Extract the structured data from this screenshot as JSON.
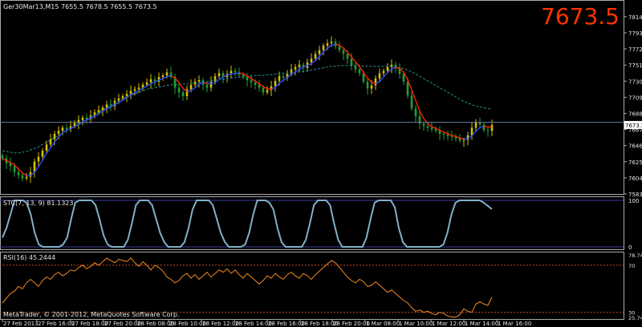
{
  "header": {
    "symbol_info": "Ger30Mar13,M15  7655.5 7678.5 7655.5 7673.5",
    "big_price": "7673.5"
  },
  "colors": {
    "up": "#d4c100",
    "down": "#1ea233",
    "fast_ma": "#ff2200",
    "slow_ma": "#2a8f8f",
    "blue_ma": "#2d49ff",
    "stc": "#7fb0c8",
    "rsi": "#f08a1e",
    "level": "#c84a1e",
    "price_line": "#6a7fa0"
  },
  "copyright": "MetaTrader, © 2001-2012, MetaQuotes Software Corp.",
  "chart_data": [
    {
      "type": "candlestick",
      "name": "main",
      "y_ticks": [
        "7814.6",
        "7793.6",
        "7772.6",
        "7751.6",
        "7730.6",
        "7709.6",
        "7688.6",
        "7667.6",
        "7646.6",
        "7625.6",
        "7604.6",
        "7583.6"
      ],
      "ylim": [
        7583.6,
        7828
      ],
      "current_price_label": "7673.5",
      "current_price": 7673.5,
      "bid_level": 7677,
      "x_labels": [
        "27 Feb 2013",
        "27 Feb 16:00",
        "27 Feb 18:00",
        "27 Feb 20:00",
        "28 Feb 08:00",
        "28 Feb 10:00",
        "28 Feb 12:00",
        "28 Feb 14:00",
        "28 Feb 16:00",
        "28 Feb 18:00",
        "28 Feb 20:00",
        "1 Mar 08:00",
        "1 Mar 10:00",
        "1 Mar 12:00",
        "1 Mar 14:00",
        "1 Mar 16:00"
      ],
      "close": [
        7630,
        7624,
        7620,
        7612,
        7608,
        7604,
        7606,
        7612,
        7626,
        7632,
        7640,
        7648,
        7655,
        7662,
        7666,
        7670,
        7668,
        7672,
        7676,
        7680,
        7683,
        7681,
        7686,
        7690,
        7693,
        7696,
        7700,
        7698,
        7705,
        7708,
        7711,
        7714,
        7718,
        7720,
        7722,
        7726,
        7729,
        7733,
        7730,
        7736,
        7738,
        7742,
        7736,
        7722,
        7716,
        7711,
        7720,
        7726,
        7730,
        7732,
        7726,
        7722,
        7730,
        7737,
        7741,
        7736,
        7740,
        7744,
        7742,
        7739,
        7736,
        7732,
        7729,
        7726,
        7722,
        7716,
        7719,
        7724,
        7731,
        7737,
        7735,
        7740,
        7746,
        7749,
        7752,
        7748,
        7755,
        7760,
        7766,
        7771,
        7777,
        7780,
        7782,
        7776,
        7771,
        7766,
        7760,
        7751,
        7746,
        7741,
        7730,
        7721,
        7725,
        7734,
        7741,
        7744,
        7749,
        7752,
        7748,
        7740,
        7730,
        7712,
        7695,
        7685,
        7675,
        7672,
        7670,
        7668,
        7666,
        7662,
        7661,
        7659,
        7658,
        7656,
        7653,
        7654,
        7660,
        7670,
        7677,
        7674,
        7667,
        7666,
        7673.5
      ],
      "sma_slow": [
        7640,
        7639,
        7638,
        7637,
        7637,
        7638,
        7639,
        7641,
        7643,
        7645,
        7648,
        7651,
        7654,
        7657,
        7660,
        7663,
        7666,
        7669,
        7672,
        7675,
        7678,
        7681,
        7684,
        7687,
        7690,
        7693,
        7696,
        7699,
        7702,
        7705,
        7708,
        7710,
        7712,
        7714,
        7716,
        7718,
        7720,
        7721,
        7722,
        7723,
        7724,
        7725,
        7726,
        7726,
        7726,
        7727,
        7727,
        7728,
        7728,
        7729,
        7729,
        7730,
        7731,
        7732,
        7733,
        7733,
        7734,
        7735,
        7735,
        7736,
        7736,
        7737,
        7737,
        7738,
        7738,
        7738,
        7739,
        7739,
        7740,
        7740,
        7741,
        7741,
        7742,
        7742,
        7743,
        7743,
        7744,
        7745,
        7746,
        7747,
        7748,
        7749,
        7750,
        7750,
        7751,
        7751,
        7751,
        7751,
        7751,
        7751,
        7750,
        7750,
        7750,
        7750,
        7750,
        7750,
        7750,
        7750,
        7749,
        7748,
        7747,
        7745,
        7743,
        7740,
        7737,
        7734,
        7731,
        7728,
        7725,
        7722,
        7719,
        7716,
        7713,
        7710,
        7707,
        7704,
        7702,
        7700,
        7698,
        7697,
        7696,
        7695,
        7694
      ]
    },
    {
      "type": "line",
      "name": "STC",
      "label": "STC(7, 13, 9) 81.1323",
      "y_ticks": [
        "100",
        "0"
      ],
      "ylim": [
        0,
        100
      ],
      "values": [
        20,
        40,
        70,
        100,
        100,
        100,
        95,
        70,
        30,
        5,
        0,
        0,
        0,
        0,
        0,
        5,
        20,
        60,
        95,
        100,
        100,
        100,
        100,
        90,
        60,
        25,
        5,
        0,
        0,
        0,
        0,
        15,
        50,
        90,
        100,
        100,
        100,
        90,
        60,
        30,
        10,
        0,
        0,
        0,
        0,
        10,
        40,
        80,
        100,
        100,
        100,
        100,
        90,
        60,
        30,
        10,
        0,
        0,
        0,
        0,
        5,
        30,
        70,
        100,
        100,
        100,
        95,
        80,
        40,
        10,
        0,
        0,
        0,
        0,
        0,
        15,
        50,
        90,
        100,
        100,
        100,
        90,
        50,
        15,
        0,
        0,
        0,
        0,
        0,
        0,
        20,
        60,
        95,
        100,
        100,
        100,
        100,
        85,
        40,
        10,
        0,
        0,
        0,
        0,
        0,
        0,
        0,
        0,
        0,
        5,
        30,
        70,
        95,
        100,
        100,
        100,
        100,
        100,
        100,
        95,
        88,
        81
      ]
    },
    {
      "type": "line",
      "name": "RSI",
      "label": "RSI(16) 45.2444",
      "y_ticks": [
        "70",
        "78.7437",
        "30",
        "25.7491"
      ],
      "ylim": [
        25.7491,
        78.7437
      ],
      "levels": [
        70,
        30
      ],
      "values": [
        38,
        42,
        46,
        48,
        52,
        50,
        55,
        58,
        55,
        52,
        57,
        60,
        58,
        62,
        64,
        61,
        63,
        66,
        65,
        68,
        70,
        67,
        69,
        72,
        70,
        73,
        76,
        74,
        72,
        75,
        74,
        73,
        76,
        72,
        69,
        73,
        70,
        66,
        70,
        68,
        65,
        60,
        58,
        55,
        57,
        61,
        63,
        59,
        62,
        58,
        61,
        64,
        60,
        63,
        66,
        64,
        67,
        63,
        66,
        62,
        59,
        63,
        60,
        57,
        54,
        57,
        61,
        59,
        63,
        60,
        58,
        62,
        64,
        61,
        59,
        63,
        61,
        58,
        62,
        65,
        68,
        71,
        74,
        72,
        68,
        64,
        60,
        57,
        55,
        58,
        56,
        52,
        53,
        56,
        53,
        50,
        47,
        49,
        46,
        43,
        40,
        38,
        34,
        31,
        32,
        30,
        31,
        29,
        28,
        30,
        29,
        27,
        26,
        26,
        28,
        33,
        31,
        30,
        37,
        39,
        37,
        36,
        43
      ]
    }
  ]
}
